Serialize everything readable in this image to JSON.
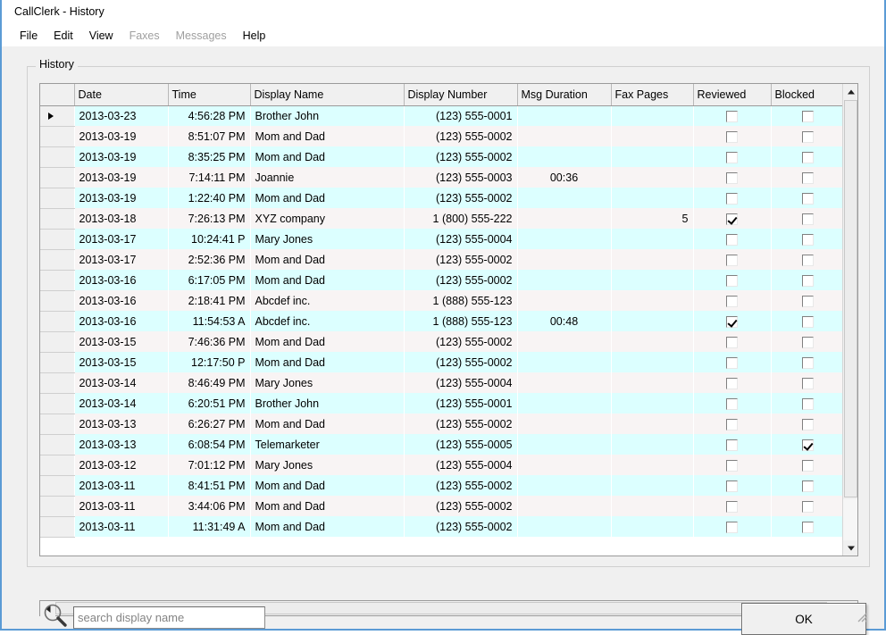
{
  "window": {
    "title": "CallClerk - History",
    "accent_border": "#5b9bd5",
    "row_color_a": "#dcffff",
    "row_color_b": "#f8f4f4"
  },
  "menubar": {
    "items": [
      {
        "label": "File",
        "disabled": false
      },
      {
        "label": "Edit",
        "disabled": false
      },
      {
        "label": "View",
        "disabled": false
      },
      {
        "label": "Faxes",
        "disabled": true
      },
      {
        "label": "Messages",
        "disabled": true
      },
      {
        "label": "Help",
        "disabled": false
      }
    ]
  },
  "group": {
    "legend": "History"
  },
  "grid": {
    "columns": [
      {
        "key": "marker",
        "label": ""
      },
      {
        "key": "date",
        "label": "Date"
      },
      {
        "key": "time",
        "label": "Time"
      },
      {
        "key": "name",
        "label": "Display Name"
      },
      {
        "key": "number",
        "label": "Display Number"
      },
      {
        "key": "duration",
        "label": "Msg Duration"
      },
      {
        "key": "fax_pages",
        "label": "Fax Pages"
      },
      {
        "key": "reviewed",
        "label": "Reviewed"
      },
      {
        "key": "blocked",
        "label": "Blocked"
      }
    ],
    "rows": [
      {
        "current": true,
        "date": "2013-03-23",
        "time": "4:56:28 PM",
        "name": "Brother John",
        "number": "(123) 555-0001",
        "duration": "",
        "fax_pages": "",
        "reviewed": false,
        "blocked": false
      },
      {
        "current": false,
        "date": "2013-03-19",
        "time": "8:51:07 PM",
        "name": "Mom and Dad",
        "number": "(123) 555-0002",
        "duration": "",
        "fax_pages": "",
        "reviewed": false,
        "blocked": false
      },
      {
        "current": false,
        "date": "2013-03-19",
        "time": "8:35:25 PM",
        "name": "Mom and Dad",
        "number": "(123) 555-0002",
        "duration": "",
        "fax_pages": "",
        "reviewed": false,
        "blocked": false
      },
      {
        "current": false,
        "date": "2013-03-19",
        "time": "7:14:11 PM",
        "name": "Joannie",
        "number": "(123) 555-0003",
        "duration": "00:36",
        "fax_pages": "",
        "reviewed": false,
        "blocked": false
      },
      {
        "current": false,
        "date": "2013-03-19",
        "time": "1:22:40 PM",
        "name": "Mom and Dad",
        "number": "(123) 555-0002",
        "duration": "",
        "fax_pages": "",
        "reviewed": false,
        "blocked": false
      },
      {
        "current": false,
        "date": "2013-03-18",
        "time": "7:26:13 PM",
        "name": "XYZ company",
        "number": "1 (800) 555-222",
        "duration": "",
        "fax_pages": "5",
        "reviewed": true,
        "blocked": false
      },
      {
        "current": false,
        "date": "2013-03-17",
        "time": "10:24:41 P",
        "name": "Mary Jones",
        "number": "(123) 555-0004",
        "duration": "",
        "fax_pages": "",
        "reviewed": false,
        "blocked": false
      },
      {
        "current": false,
        "date": "2013-03-17",
        "time": "2:52:36 PM",
        "name": "Mom and Dad",
        "number": "(123) 555-0002",
        "duration": "",
        "fax_pages": "",
        "reviewed": false,
        "blocked": false
      },
      {
        "current": false,
        "date": "2013-03-16",
        "time": "6:17:05 PM",
        "name": "Mom and Dad",
        "number": "(123) 555-0002",
        "duration": "",
        "fax_pages": "",
        "reviewed": false,
        "blocked": false
      },
      {
        "current": false,
        "date": "2013-03-16",
        "time": "2:18:41 PM",
        "name": "Abcdef inc.",
        "number": "1 (888) 555-123",
        "duration": "",
        "fax_pages": "",
        "reviewed": false,
        "blocked": false
      },
      {
        "current": false,
        "date": "2013-03-16",
        "time": "11:54:53 A",
        "name": "Abcdef inc.",
        "number": "1 (888) 555-123",
        "duration": "00:48",
        "fax_pages": "",
        "reviewed": true,
        "blocked": false
      },
      {
        "current": false,
        "date": "2013-03-15",
        "time": "7:46:36 PM",
        "name": "Mom and Dad",
        "number": "(123) 555-0002",
        "duration": "",
        "fax_pages": "",
        "reviewed": false,
        "blocked": false
      },
      {
        "current": false,
        "date": "2013-03-15",
        "time": "12:17:50 P",
        "name": "Mom and Dad",
        "number": "(123) 555-0002",
        "duration": "",
        "fax_pages": "",
        "reviewed": false,
        "blocked": false
      },
      {
        "current": false,
        "date": "2013-03-14",
        "time": "8:46:49 PM",
        "name": "Mary Jones",
        "number": "(123) 555-0004",
        "duration": "",
        "fax_pages": "",
        "reviewed": false,
        "blocked": false
      },
      {
        "current": false,
        "date": "2013-03-14",
        "time": "6:20:51 PM",
        "name": "Brother John",
        "number": "(123) 555-0001",
        "duration": "",
        "fax_pages": "",
        "reviewed": false,
        "blocked": false
      },
      {
        "current": false,
        "date": "2013-03-13",
        "time": "6:26:27 PM",
        "name": "Mom and Dad",
        "number": "(123) 555-0002",
        "duration": "",
        "fax_pages": "",
        "reviewed": false,
        "blocked": false
      },
      {
        "current": false,
        "date": "2013-03-13",
        "time": "6:08:54 PM",
        "name": "Telemarketer",
        "number": "(123) 555-0005",
        "duration": "",
        "fax_pages": "",
        "reviewed": false,
        "blocked": true
      },
      {
        "current": false,
        "date": "2013-03-12",
        "time": "7:01:12 PM",
        "name": "Mary Jones",
        "number": "(123) 555-0004",
        "duration": "",
        "fax_pages": "",
        "reviewed": false,
        "blocked": false
      },
      {
        "current": false,
        "date": "2013-03-11",
        "time": "8:41:51 PM",
        "name": "Mom and Dad",
        "number": "(123) 555-0002",
        "duration": "",
        "fax_pages": "",
        "reviewed": false,
        "blocked": false
      },
      {
        "current": false,
        "date": "2013-03-11",
        "time": "3:44:06 PM",
        "name": "Mom and Dad",
        "number": "(123) 555-0002",
        "duration": "",
        "fax_pages": "",
        "reviewed": false,
        "blocked": false
      },
      {
        "current": false,
        "date": "2013-03-11",
        "time": "11:31:49 A",
        "name": "Mom and Dad",
        "number": "(123) 555-0002",
        "duration": "",
        "fax_pages": "",
        "reviewed": false,
        "blocked": false
      }
    ]
  },
  "footer": {
    "search": {
      "value": "",
      "placeholder": "search display name",
      "icon": "magnifier-icon"
    },
    "ok_label": "OK"
  }
}
